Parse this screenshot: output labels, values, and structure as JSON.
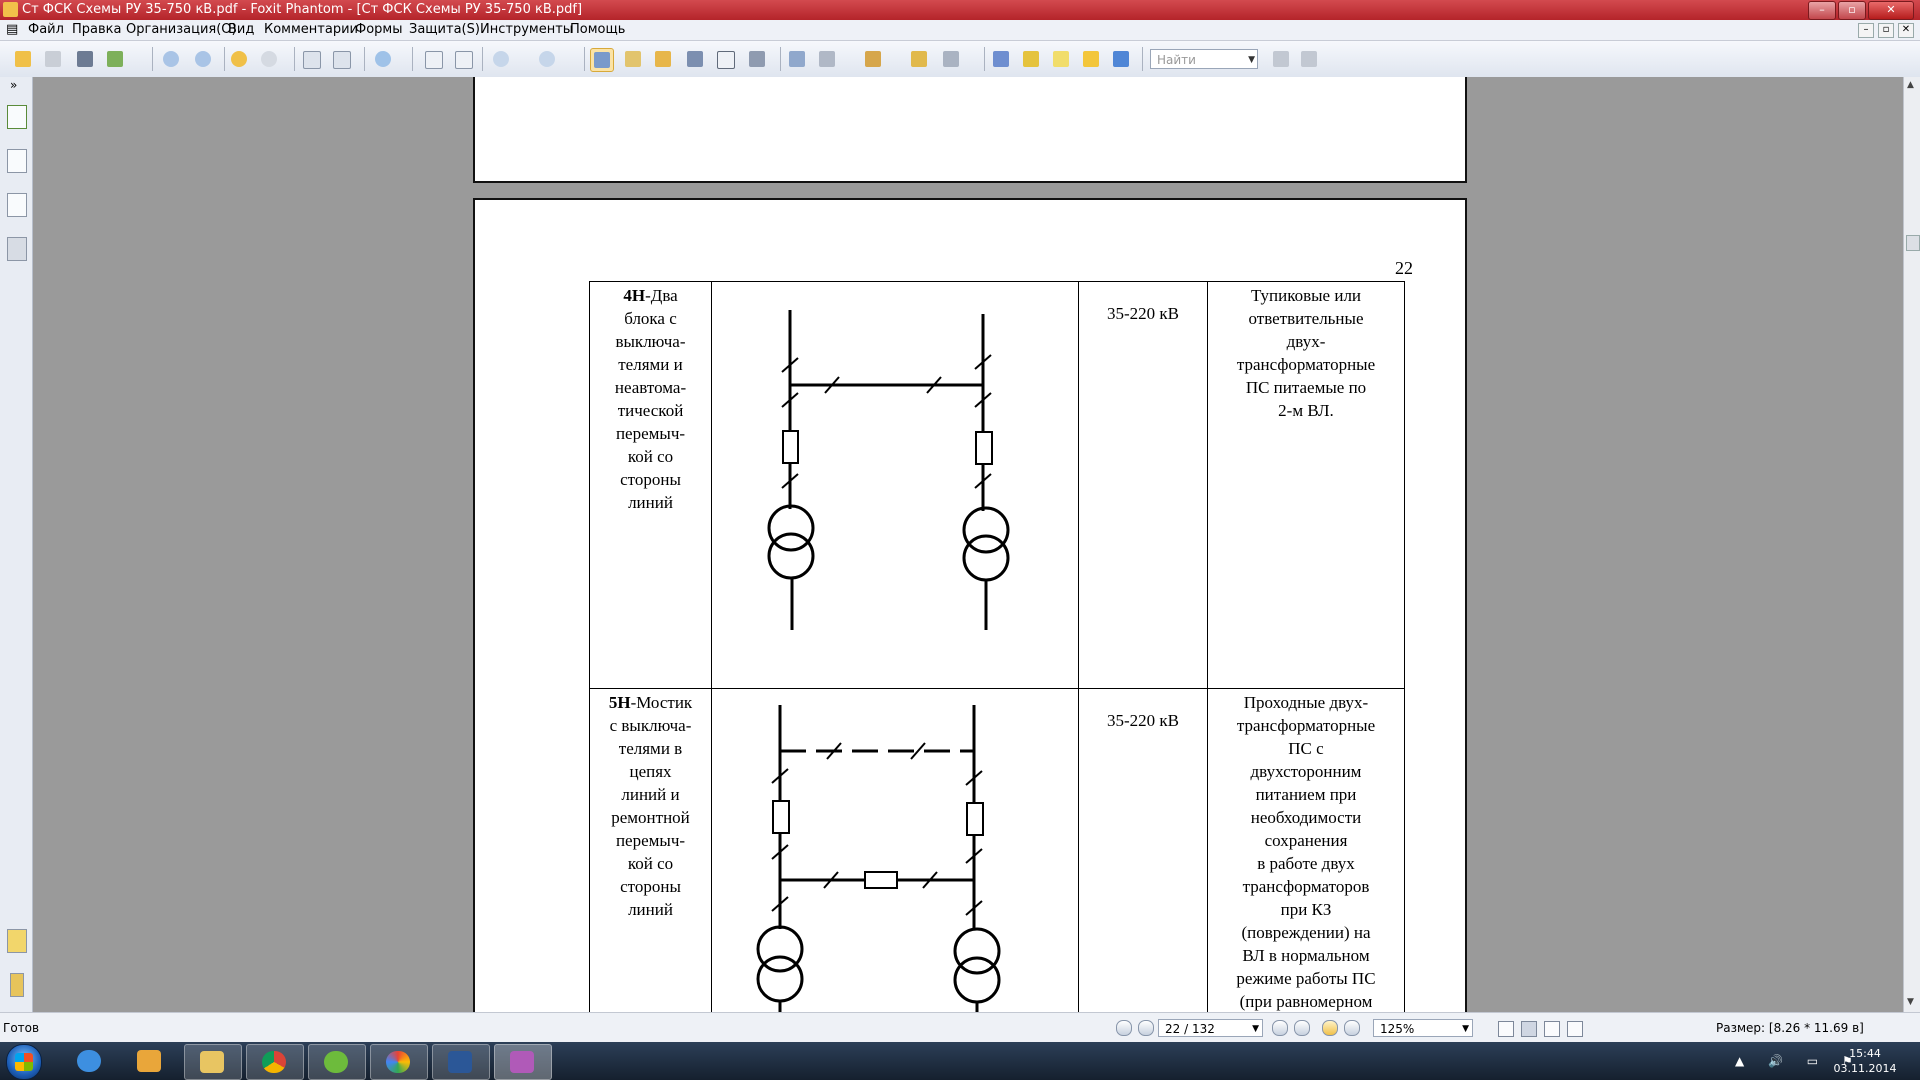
{
  "window": {
    "title": "Ст ФСК Схемы РУ 35-750 кВ.pdf - Foxit Phantom - [Ст ФСК Схемы РУ 35-750 кВ.pdf]",
    "buttons": [
      "–",
      "▫",
      "✕"
    ],
    "mdi_buttons": [
      "–",
      "▫",
      "✕"
    ]
  },
  "menu": [
    "Файл",
    "Правка",
    "Организация(O)",
    "Вид",
    "Комментарии",
    "Формы",
    "Защита(S)",
    "Инструменты",
    "Помощь"
  ],
  "toolbar": {
    "find_placeholder": "Найти",
    "icons": [
      "open-icon",
      "save-icon",
      "print-icon",
      "email-icon",
      "prev-page-icon",
      "next-page-icon",
      "back-icon",
      "forward-icon",
      "rotate-left-icon",
      "rotate-right-icon",
      "zoom-icon",
      "fit-page-icon",
      "fit-width-icon",
      "zoom-out-icon",
      "zoom-in-icon",
      "hand-tool-icon",
      "select-text-icon",
      "select-icon",
      "find-icon",
      "typewriter-icon",
      "snapshot-icon",
      "form-icon",
      "pen-icon",
      "stamp-icon",
      "attach-icon",
      "lock-icon",
      "note-icon",
      "highlight-icon",
      "text-icon",
      "comment-icon",
      "arrow-icon"
    ]
  },
  "page": {
    "number": "22",
    "rows": [
      {
        "code": "4Н",
        "name_lines": [
          "-Два",
          "блока с",
          "выключа-",
          "телями и",
          "неавтома-",
          "тической",
          "перемыч-",
          "кой со",
          "стороны",
          "линий"
        ],
        "voltage": "35-220 кВ",
        "application_lines": [
          "Тупиковые или",
          "ответвительные",
          "двух-",
          "трансформаторные",
          "ПС питаемые по",
          "2-м ВЛ."
        ]
      },
      {
        "code": "5Н",
        "name_lines": [
          "-Мостик",
          "с выключа-",
          "телями в",
          "цепях",
          "линий и",
          "ремонтной",
          "перемыч-",
          "кой со",
          "стороны",
          "линий"
        ],
        "voltage": "35-220 кВ",
        "application_lines": [
          "Проходные двух-",
          "трансформаторные",
          "ПС с",
          "двухсторонним",
          "питанием при",
          "необходимости",
          "сохранения",
          "в работе двух",
          "трансформаторов",
          "при КЗ",
          "(повреждении) на",
          "ВЛ  в  нормальном",
          "режиме работы ПС",
          "(при равномерном"
        ]
      }
    ]
  },
  "status": {
    "text": "Готов",
    "page_indicator": "22 / 132",
    "zoom": "125%",
    "size": "Размер: [8.26 * 11.69 в]"
  },
  "taskbar": {
    "apps": [
      "internet-explorer",
      "media-player",
      "file-explorer",
      "chrome",
      "utorrent",
      "picasa",
      "word",
      "foxit-phantom"
    ],
    "tray_icons": "▲ 🔊 ▭ ⚑",
    "time": "15:44",
    "date": "03.11.2014"
  },
  "colors": {
    "titlebar": "#c0323a",
    "doc_background": "#9a9a9a",
    "taskbar": "#1d2b3c"
  }
}
